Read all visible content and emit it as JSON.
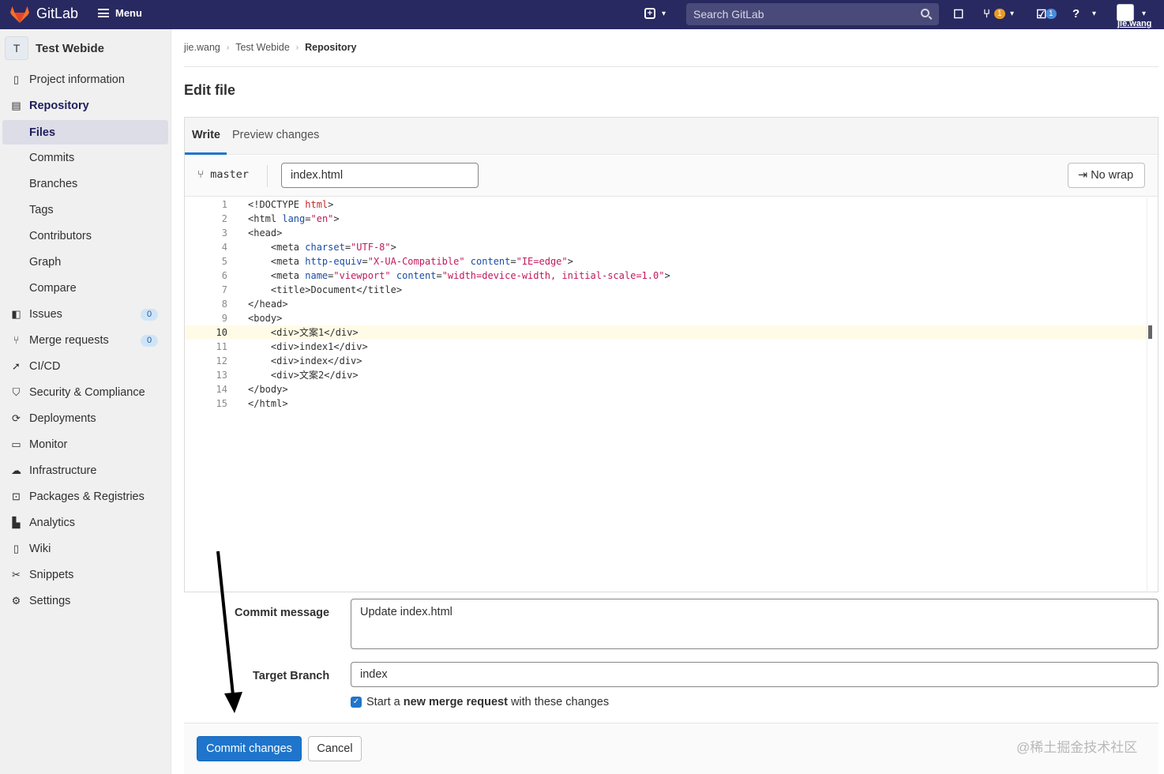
{
  "topbar": {
    "brand": "GitLab",
    "menu_label": "Menu",
    "search_placeholder": "Search GitLab",
    "mr_count": "1",
    "todo_count": "1",
    "username": "jie.wang"
  },
  "sidebar": {
    "project_initial": "T",
    "project_name": "Test Webide",
    "items": [
      {
        "label": "Project information",
        "icon": "info-icon"
      },
      {
        "label": "Repository",
        "icon": "doc-icon"
      },
      {
        "label": "Files"
      },
      {
        "label": "Commits"
      },
      {
        "label": "Branches"
      },
      {
        "label": "Tags"
      },
      {
        "label": "Contributors"
      },
      {
        "label": "Graph"
      },
      {
        "label": "Compare"
      },
      {
        "label": "Issues",
        "icon": "issues-icon",
        "badge": "0"
      },
      {
        "label": "Merge requests",
        "icon": "merge-request-icon",
        "badge": "0"
      },
      {
        "label": "CI/CD",
        "icon": "rocket-icon"
      },
      {
        "label": "Security & Compliance",
        "icon": "shield-icon"
      },
      {
        "label": "Deployments",
        "icon": "deployments-icon"
      },
      {
        "label": "Monitor",
        "icon": "monitor-icon"
      },
      {
        "label": "Infrastructure",
        "icon": "cloud-icon"
      },
      {
        "label": "Packages & Registries",
        "icon": "package-icon"
      },
      {
        "label": "Analytics",
        "icon": "chart-icon"
      },
      {
        "label": "Wiki",
        "icon": "book-icon"
      },
      {
        "label": "Snippets",
        "icon": "scissors-icon"
      },
      {
        "label": "Settings",
        "icon": "gear-icon"
      }
    ]
  },
  "breadcrumb": {
    "items": [
      "jie.wang",
      "Test Webide"
    ],
    "current": "Repository"
  },
  "page_title": "Edit file",
  "editor": {
    "tab_write": "Write",
    "tab_preview": "Preview changes",
    "branch": "master",
    "file_name": "index.html",
    "wrap_button": "No wrap",
    "current_line": 10,
    "lines": [
      "<!DOCTYPE html>",
      "<html lang=\"en\">",
      "<head>",
      "    <meta charset=\"UTF-8\">",
      "    <meta http-equiv=\"X-UA-Compatible\" content=\"IE=edge\">",
      "    <meta name=\"viewport\" content=\"width=device-width, initial-scale=1.0\">",
      "    <title>Document</title>",
      "</head>",
      "<body>",
      "    <div>文案1</div>",
      "    <div>index1</div>",
      "    <div>index</div>",
      "    <div>文案2</div>",
      "</body>",
      "</html>"
    ]
  },
  "commit": {
    "message_label": "Commit message",
    "message_value": "Update index.html",
    "branch_label": "Target Branch",
    "branch_value": "index",
    "mr_checkbox_prefix": "Start a ",
    "mr_checkbox_bold": "new merge request",
    "mr_checkbox_suffix": " with these changes",
    "mr_checked": true,
    "commit_button": "Commit changes",
    "cancel_button": "Cancel"
  },
  "watermark": "@稀土掘金技术社区",
  "colors": {
    "topbar_bg": "#292961",
    "primary": "#1f75cb",
    "badge_orange": "#e69c28"
  }
}
